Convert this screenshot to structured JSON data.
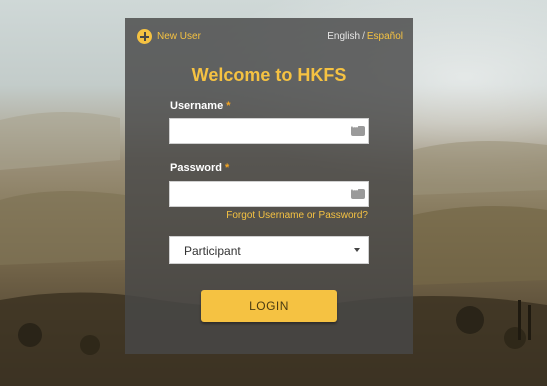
{
  "header": {
    "new_user_label": "New User",
    "lang_en": "English",
    "lang_sep": "/",
    "lang_es": "Español"
  },
  "form": {
    "title": "Welcome to HKFS",
    "username_label": "Username",
    "password_label": "Password",
    "required_mark": "*",
    "username_value": "",
    "password_value": "",
    "forgot_link": "Forgot Username or Password?",
    "role_selected": "Participant",
    "login_label": "LOGIN"
  },
  "colors": {
    "accent": "#f5c242",
    "panel": "#484848"
  }
}
